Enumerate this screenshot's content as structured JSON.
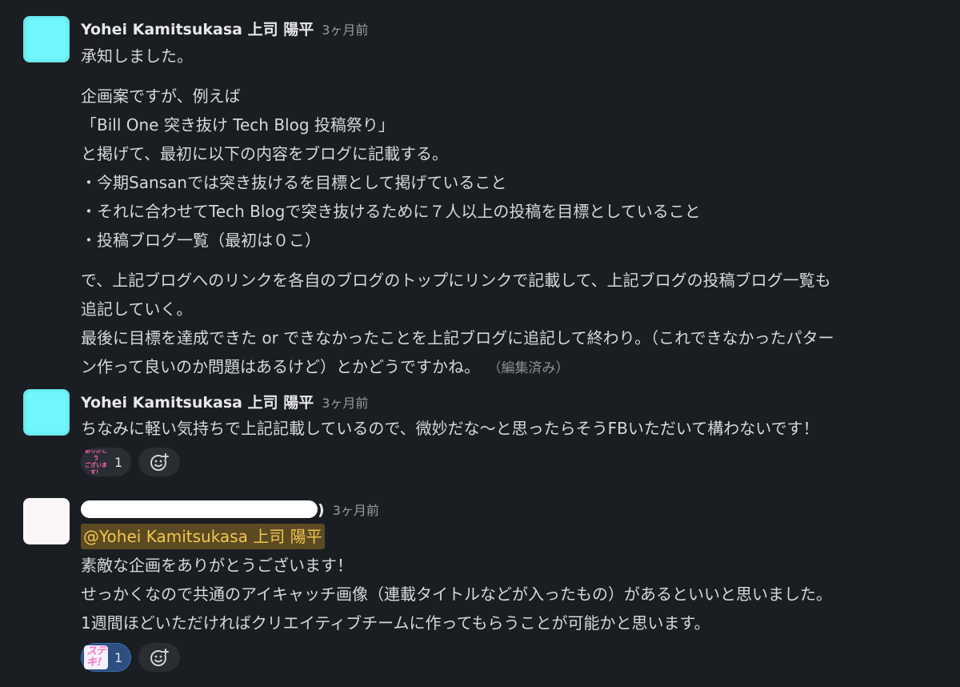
{
  "messages": [
    {
      "author": "Yohei Kamitsukasa 上司 陽平",
      "time": "3ヶ月前",
      "lines": [
        "承知しました。",
        "",
        "企画案ですが、例えば",
        "「Bill One 突き抜け Tech Blog 投稿祭り」",
        "と掲げて、最初に以下の内容をブログに記載する。",
        "・今期Sansanでは突き抜けるを目標として掲げていること",
        "・それに合わせてTech Blogで突き抜けるために７人以上の投稿を目標としていること",
        "・投稿ブログ一覧（最初は０こ）",
        "",
        "で、上記ブログへのリンクを各自のブログのトップにリンクで記載して、上記ブログの投稿ブログ一覧も",
        "追記していく。",
        "最後に目標を達成できた or できなかったことを上記ブログに追記して終わり。（これできなかったパター",
        "ン作って良いのか問題はあるけど）とかどうですかね。"
      ],
      "edited": "（編集済み）"
    },
    {
      "author": "Yohei Kamitsukasa 上司 陽平",
      "time": "3ヶ月前",
      "lines": [
        "ちなみに軽い気持ちで上記記載しているので、微妙だな〜と思ったらそうFBいただいて構わないです！"
      ],
      "reaction": {
        "emoji": "ありがとうございます！",
        "emoji_line1": "ありがとう",
        "emoji_line2": "ございます！",
        "count": "1"
      }
    },
    {
      "time": "3ヶ月前",
      "author_suffix": ")",
      "mention": "@Yohei Kamitsukasa 上司 陽平",
      "lines": [
        "素敵な企画をありがとうございます！",
        "せっかくなので共通のアイキャッチ画像（連載タイトルなどが入ったもの）があるといいと思いました。",
        "1週間ほどいただければクリエイティブチームに作ってもらうことが可能かと思います。"
      ],
      "reaction": {
        "emoji": "ステキ！",
        "count": "1"
      }
    }
  ],
  "icons": {
    "add_reaction": "add-reaction-icon"
  },
  "colors": {
    "background": "#1a1d21",
    "text": "#d1d2d3",
    "mention_bg": "#5c4a23",
    "mention_text": "#f2c74e",
    "active_reaction_bg": "#2c4f80"
  }
}
